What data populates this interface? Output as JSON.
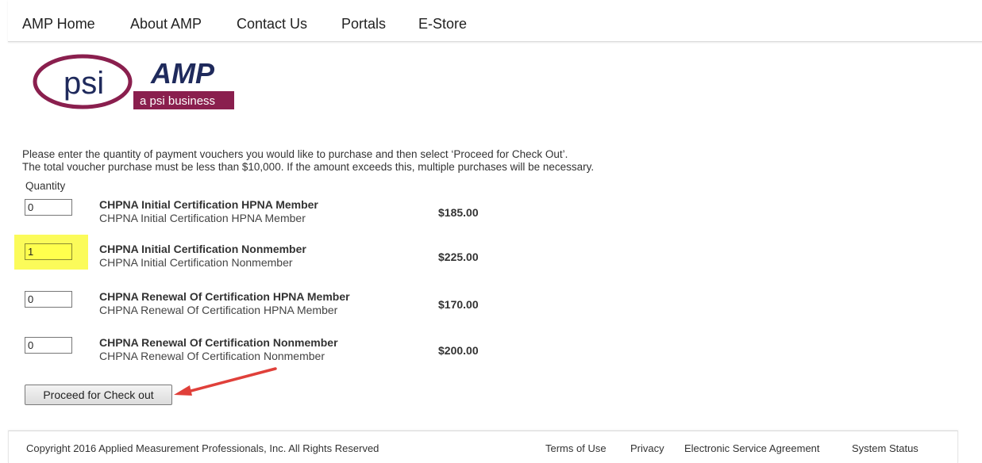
{
  "nav": {
    "items": [
      "AMP Home",
      "About AMP",
      "Contact Us",
      "Portals",
      "E-Store"
    ]
  },
  "logo": {
    "psi_text": "psi",
    "amp_text": "AMP",
    "tagline": "a psi business",
    "colors": {
      "psi_maroon": "#8a1f4e",
      "amp_navy": "#1f2a5c"
    }
  },
  "instructions": {
    "line1": "Please enter the quantity of payment vouchers you would like to purchase and then select ‘Proceed for Check Out’.",
    "line2": "The total voucher purchase must be less than $10,000. If the amount exceeds this, multiple purchases will be necessary."
  },
  "quantity_header": "Quantity",
  "vouchers": [
    {
      "quantity": "0",
      "name": "CHPNA Initial Certification HPNA Member",
      "description": "CHPNA Initial Certification HPNA Member",
      "price": "$185.00",
      "highlighted": false
    },
    {
      "quantity": "1",
      "name": "CHPNA Initial Certification Nonmember",
      "description": "CHPNA Initial Certification Nonmember",
      "price": "$225.00",
      "highlighted": true
    },
    {
      "quantity": "0",
      "name": "CHPNA Renewal Of Certification HPNA Member",
      "description": "CHPNA Renewal Of Certification HPNA Member",
      "price": "$170.00",
      "highlighted": false
    },
    {
      "quantity": "0",
      "name": "CHPNA Renewal Of Certification Nonmember",
      "description": "CHPNA Renewal Of Certification Nonmember",
      "price": "$200.00",
      "highlighted": false
    }
  ],
  "checkout_button": "Proceed for Check out",
  "annotation": {
    "arrow_color": "#e0403a",
    "highlight_color": "#fbfb5a"
  },
  "footer": {
    "copyright": "Copyright 2016 Applied Measurement Professionals, Inc. All Rights Reserved",
    "links": [
      "Terms of Use",
      "Privacy",
      "Electronic Service Agreement",
      "System Status"
    ]
  }
}
